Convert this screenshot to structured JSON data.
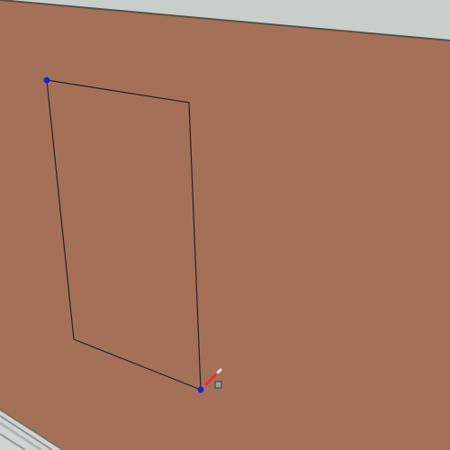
{
  "scene": {
    "wall_color": "#a47158",
    "ceiling_color": "#c8cec9",
    "ceiling_edge_color": "#5a4f49",
    "floor_color": "#cfd3d2",
    "floor_edge_color": "#8f9697",
    "outline_color": "#2a221e",
    "vertex_color": "#1f1fe0"
  },
  "tool": {
    "icon": "pencil-icon",
    "tip_color": "#e03030",
    "cursor_color": "#555555"
  }
}
